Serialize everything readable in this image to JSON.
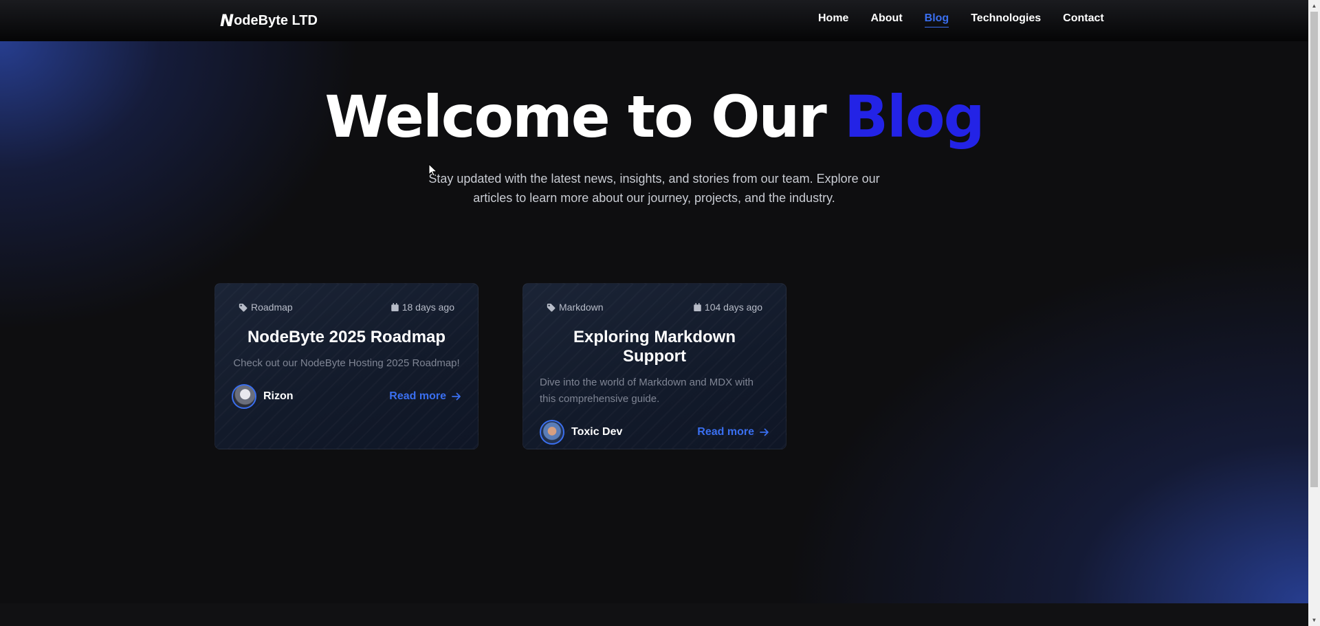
{
  "brand": {
    "mark": "N",
    "name": "odeByte LTD"
  },
  "nav": {
    "items": [
      {
        "label": "Home",
        "active": false
      },
      {
        "label": "About",
        "active": false
      },
      {
        "label": "Blog",
        "active": true
      },
      {
        "label": "Technologies",
        "active": false
      },
      {
        "label": "Contact",
        "active": false
      }
    ]
  },
  "hero": {
    "title_main": "Welcome to Our ",
    "title_accent": "Blog",
    "subtitle": "Stay updated with the latest news, insights, and stories from our team. Explore our articles to learn more about our journey, projects, and the industry."
  },
  "posts": [
    {
      "tag": "Roadmap",
      "tag_icon": "tag-icon",
      "date": "18 days ago",
      "date_icon": "calendar-icon",
      "title": "NodeByte 2025 Roadmap",
      "description": "Check out our NodeByte Hosting 2025 Roadmap!",
      "author": "Rizon",
      "read_more": "Read more",
      "read_more_icon": "arrow-right-icon"
    },
    {
      "tag": "Markdown",
      "tag_icon": "tag-icon",
      "date": "104 days ago",
      "date_icon": "calendar-icon",
      "title": "Exploring Markdown Support",
      "description": "Dive into the world of Markdown and MDX with this comprehensive guide.",
      "author": "Toxic Dev",
      "read_more": "Read more",
      "read_more_icon": "arrow-right-icon"
    }
  ],
  "colors": {
    "accent": "#3a6ff0",
    "title_accent": "#2323e6",
    "background": "#0e0e10",
    "glow": "#2840a0"
  }
}
